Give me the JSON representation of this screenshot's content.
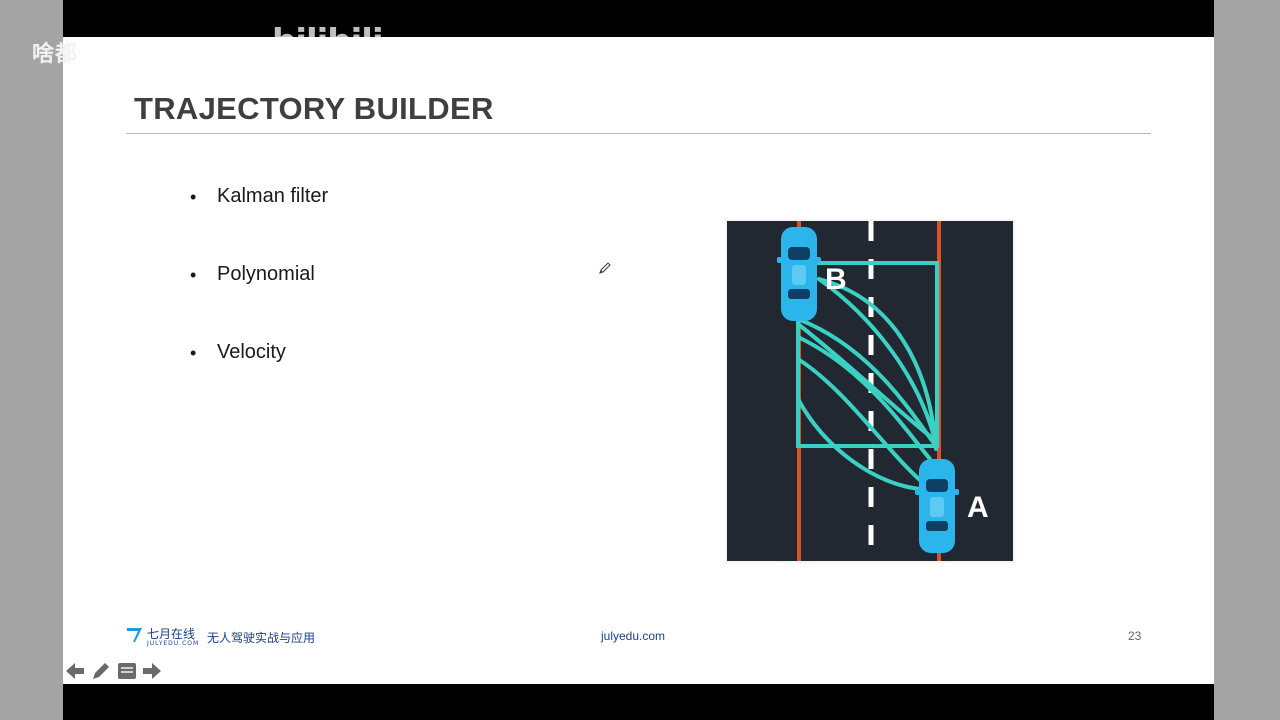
{
  "overlay": {
    "channel_text": "啥都",
    "watermark": "bilibili"
  },
  "slide": {
    "title": "TRAJECTORY BUILDER",
    "bullets": [
      {
        "text": "Kalman filter"
      },
      {
        "text": "Polynomial"
      },
      {
        "text": "Velocity"
      }
    ],
    "figure": {
      "label_b": "B",
      "label_a": "A",
      "colors": {
        "road": "#222831",
        "edge_line": "#d9522c",
        "center_dash": "#ffffff",
        "path": "#3ad1c2",
        "car_body": "#2bb5ea",
        "car_glass": "#0e3f66"
      }
    },
    "footer": {
      "brand": "七月在线",
      "brand_sub": "JULYEDU.COM",
      "course": "无人驾驶实战与应用",
      "site": "julyedu.com",
      "page_number": "23"
    }
  },
  "controls": {
    "prev_icon": "arrow-left-icon",
    "pen_icon": "pencil-icon",
    "menu_icon": "slides-menu-icon",
    "next_icon": "arrow-right-icon"
  }
}
